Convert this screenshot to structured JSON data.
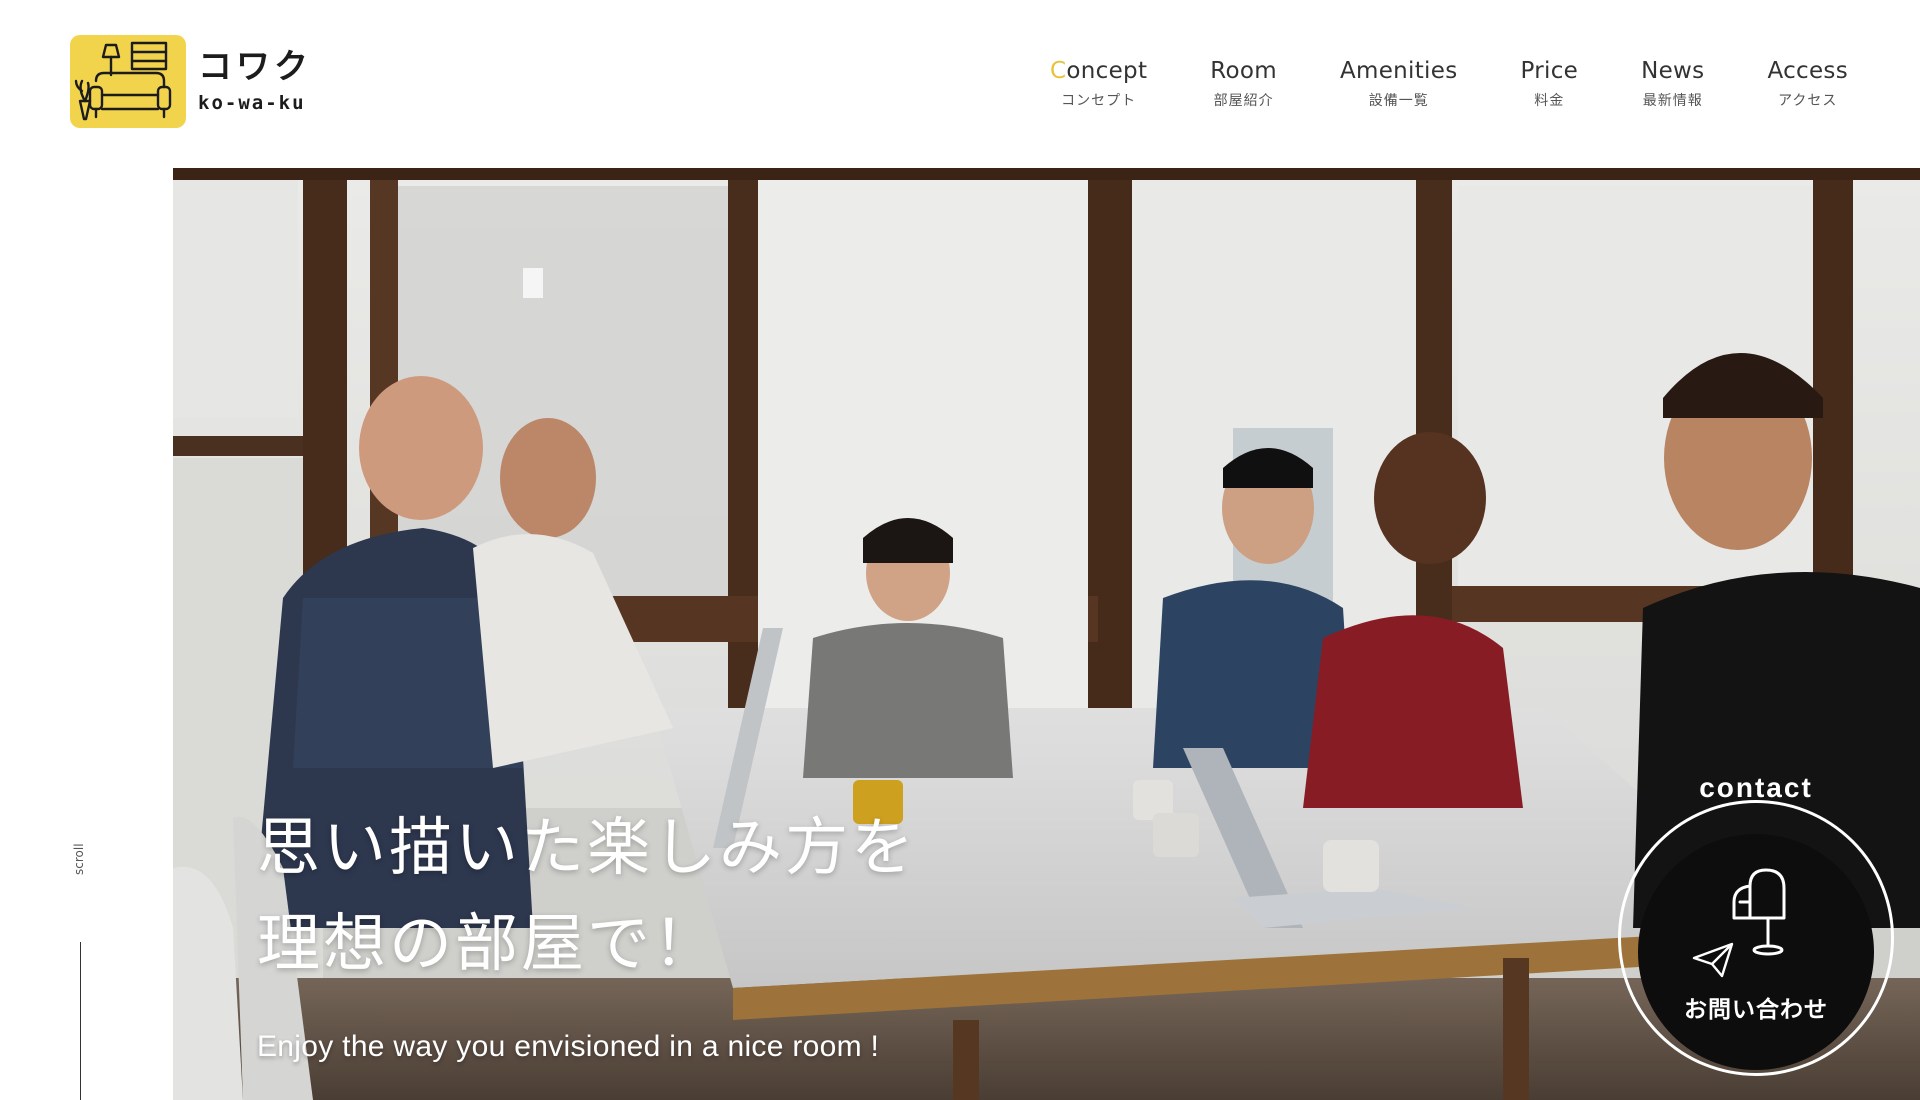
{
  "brand": {
    "name_jp": "コワク",
    "name_en": "ko-wa-ku",
    "color": "#f2d34c"
  },
  "nav": {
    "items": [
      {
        "label_en": "Concept",
        "label_jp": "コンセプト",
        "active": true
      },
      {
        "label_en": "Room",
        "label_jp": "部屋紹介"
      },
      {
        "label_en": "Amenities",
        "label_jp": "設備一覧"
      },
      {
        "label_en": "Price",
        "label_jp": "料金"
      },
      {
        "label_en": "News",
        "label_jp": "最新情報"
      },
      {
        "label_en": "Access",
        "label_jp": "アクセス"
      }
    ],
    "accent": "#e8c23a"
  },
  "scroll": {
    "label": "scroll"
  },
  "hero": {
    "title_line1": "思い描いた楽しみ方を",
    "title_line2": "理想の部屋で！",
    "subtitle": "Enjoy the way you envisioned in a nice room !"
  },
  "contact": {
    "label_en": "contact",
    "label_jp": "お問い合わせ",
    "icons": [
      "mailbox-icon",
      "paper-plane-icon"
    ]
  }
}
